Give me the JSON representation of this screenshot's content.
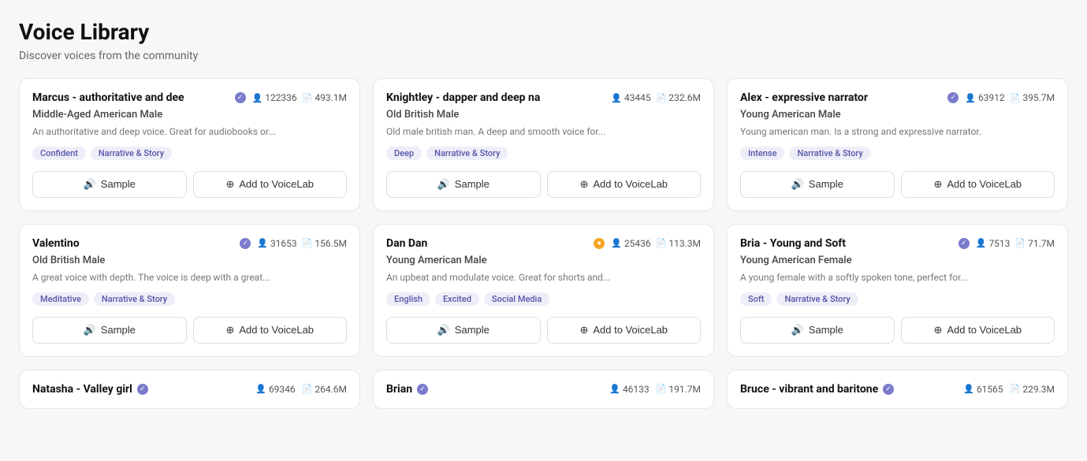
{
  "page": {
    "title": "Voice Library",
    "subtitle": "Discover voices from the community"
  },
  "cards": [
    {
      "id": "marcus",
      "title": "Marcus - authoritative and dee",
      "verified": true,
      "verified_type": "purple",
      "stat_users": "122336",
      "stat_files": "493.1M",
      "category": "Middle-Aged American Male",
      "description": "An authoritative and deep voice. Great for audiobooks or...",
      "tags": [
        "Confident",
        "Narrative & Story"
      ],
      "sample_label": "Sample",
      "add_label": "Add to VoiceLab"
    },
    {
      "id": "knightley",
      "title": "Knightley - dapper and deep na",
      "verified": false,
      "verified_type": "none",
      "stat_users": "43445",
      "stat_files": "232.6M",
      "category": "Old British Male",
      "description": "Old male british man. A deep and smooth voice for...",
      "tags": [
        "Deep",
        "Narrative & Story"
      ],
      "sample_label": "Sample",
      "add_label": "Add to VoiceLab"
    },
    {
      "id": "alex",
      "title": "Alex - expressive narrator",
      "verified": true,
      "verified_type": "purple",
      "stat_users": "63912",
      "stat_files": "395.7M",
      "category": "Young American Male",
      "description": "Young american man. Is a strong and expressive narrator.",
      "tags": [
        "Intense",
        "Narrative & Story"
      ],
      "sample_label": "Sample",
      "add_label": "Add to VoiceLab"
    },
    {
      "id": "valentino",
      "title": "Valentino",
      "verified": true,
      "verified_type": "purple",
      "stat_users": "31653",
      "stat_files": "156.5M",
      "category": "Old British Male",
      "description": "A great voice with depth. The voice is deep with a great...",
      "tags": [
        "Meditative",
        "Narrative & Story"
      ],
      "sample_label": "Sample",
      "add_label": "Add to VoiceLab"
    },
    {
      "id": "dandan",
      "title": "Dan Dan",
      "verified": true,
      "verified_type": "orange",
      "stat_users": "25436",
      "stat_files": "113.3M",
      "category": "Young American Male",
      "description": "An upbeat and modulate voice. Great for shorts and...",
      "tags": [
        "English",
        "Excited",
        "Social Media"
      ],
      "sample_label": "Sample",
      "add_label": "Add to VoiceLab"
    },
    {
      "id": "bria",
      "title": "Bria - Young and Soft",
      "verified": true,
      "verified_type": "purple",
      "stat_users": "7513",
      "stat_files": "71.7M",
      "category": "Young American Female",
      "description": "A young female with a softly spoken tone, perfect for...",
      "tags": [
        "Soft",
        "Narrative & Story"
      ],
      "sample_label": "Sample",
      "add_label": "Add to VoiceLab"
    }
  ],
  "partial_cards": [
    {
      "id": "natasha",
      "title": "Natasha - Valley girl",
      "verified": true,
      "stat_users": "69346",
      "stat_files": "264.6M"
    },
    {
      "id": "brian",
      "title": "Brian",
      "verified": true,
      "stat_users": "46133",
      "stat_files": "191.7M"
    },
    {
      "id": "bruce",
      "title": "Bruce - vibrant and baritone",
      "verified": true,
      "stat_users": "61565",
      "stat_files": "229.3M"
    }
  ],
  "icons": {
    "user": "👤",
    "file": "📄",
    "sample": "🔊",
    "add": "⊕"
  }
}
